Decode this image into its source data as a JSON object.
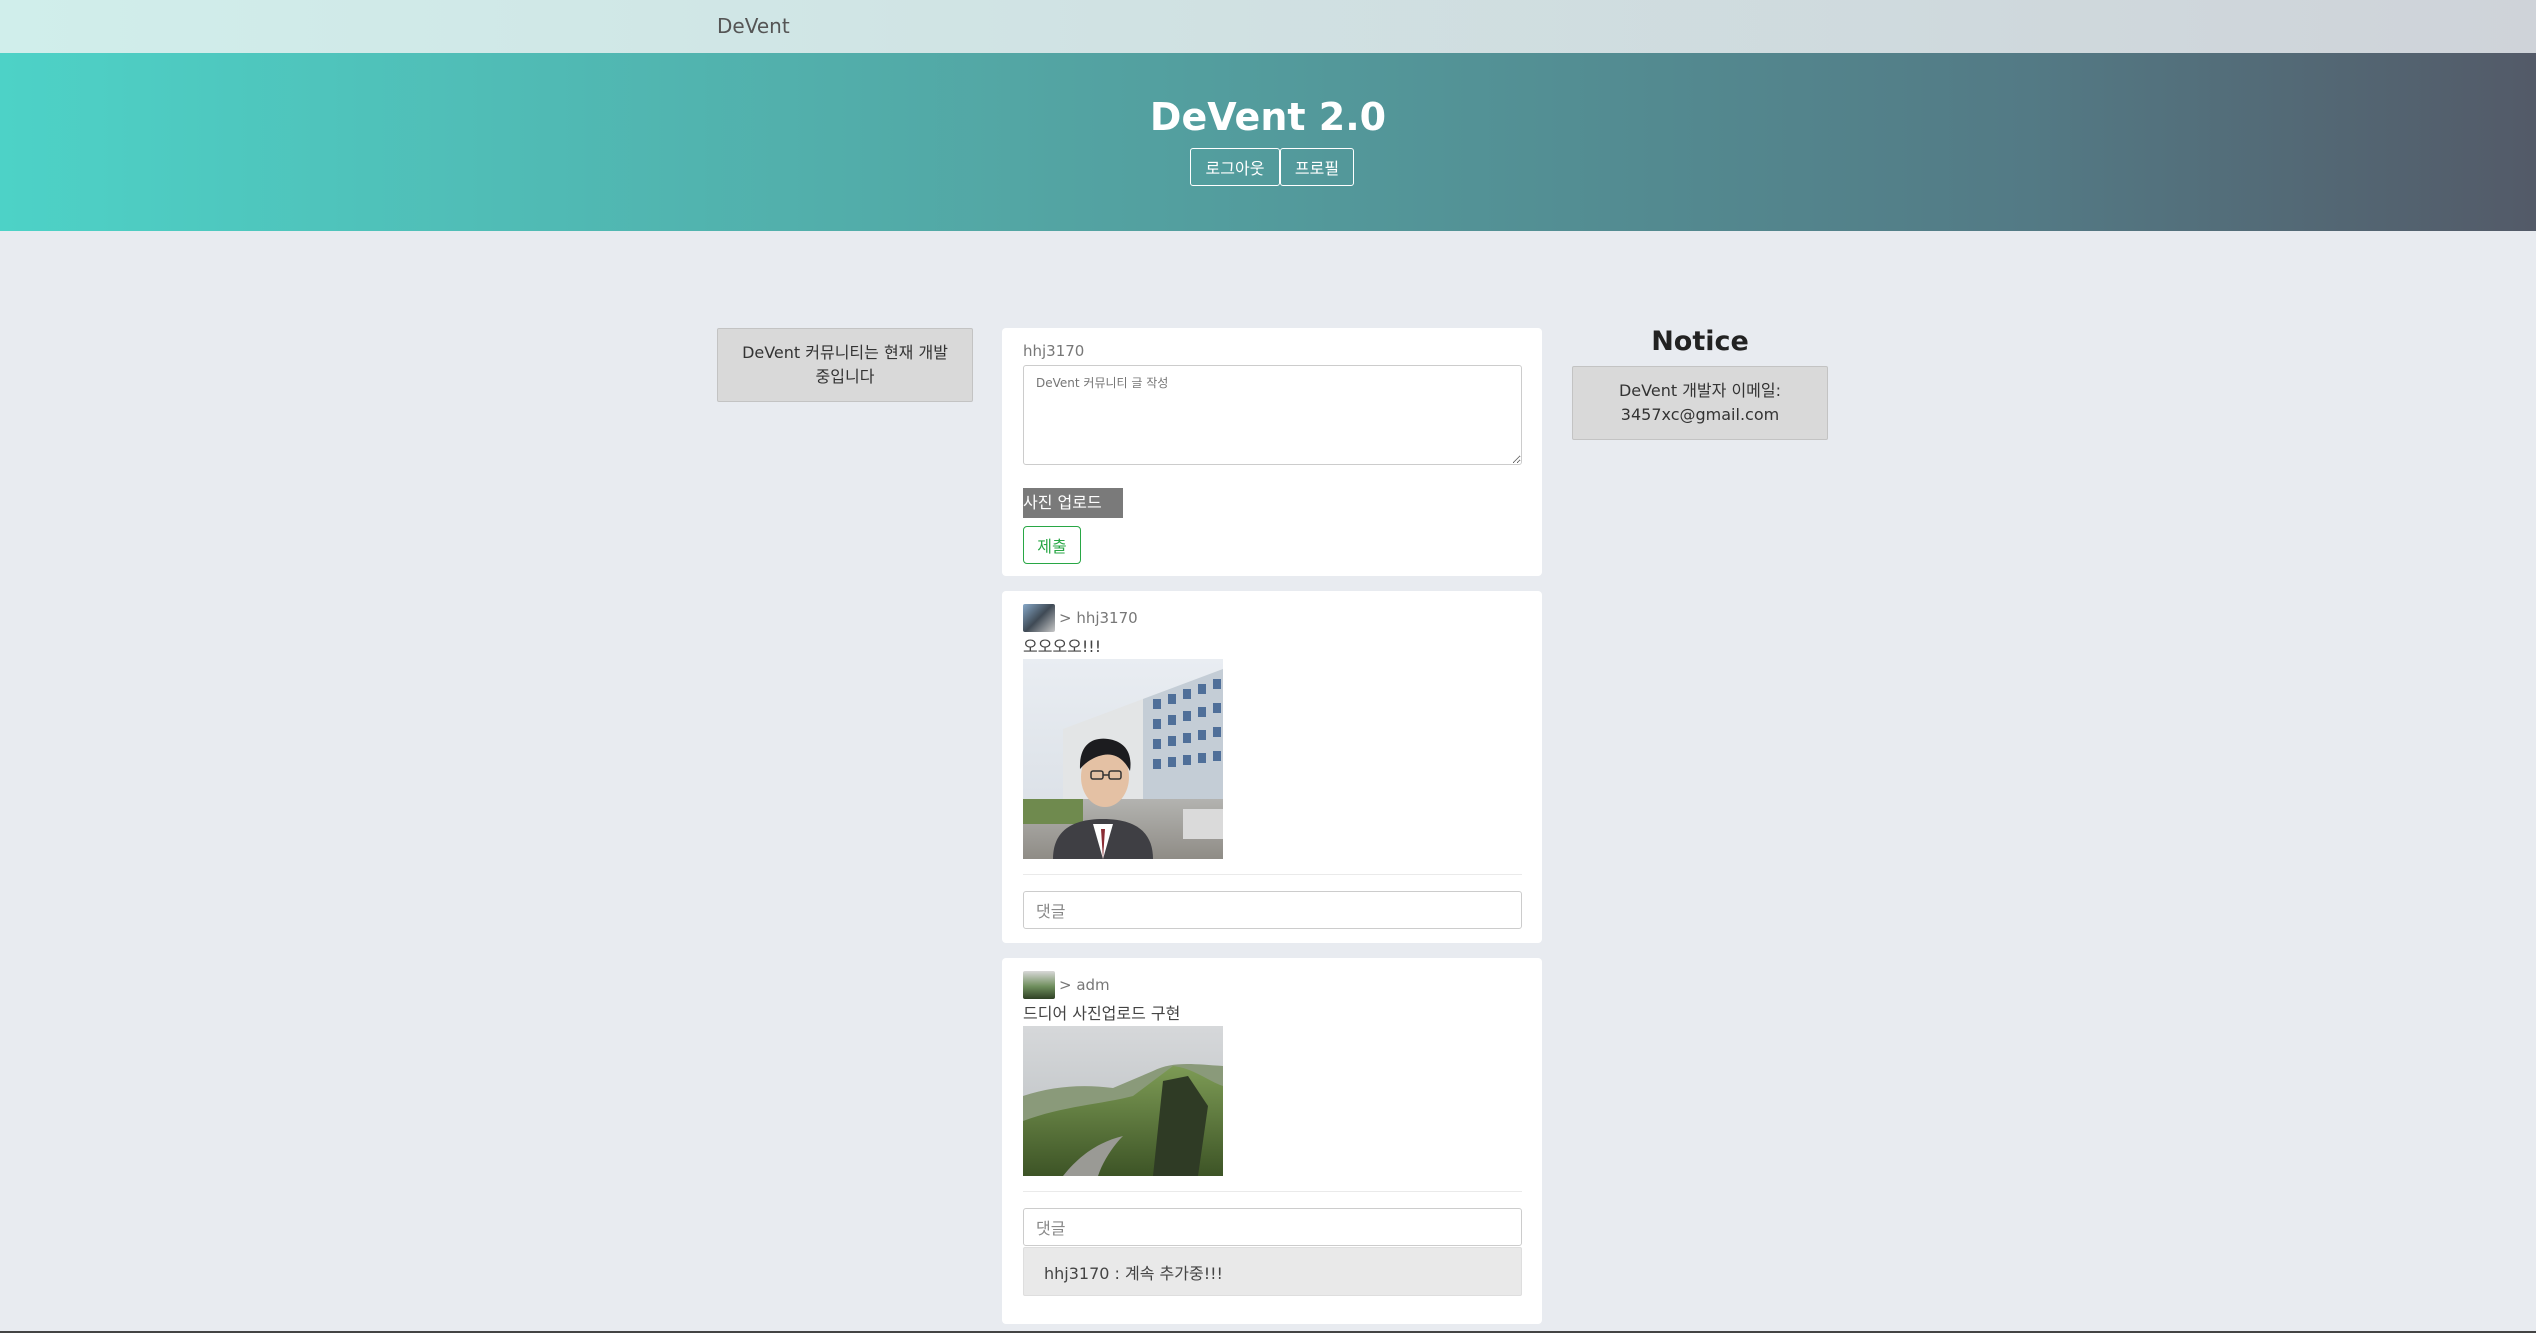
{
  "nav": {
    "brand": "DeVent"
  },
  "hero": {
    "title": "DeVent 2.0",
    "logout_label": "로그아웃",
    "profile_label": "프로필"
  },
  "left_panel": {
    "text": "DeVent 커뮤니티는 현재 개발 중입니다"
  },
  "notice": {
    "title": "Notice",
    "line1": "DeVent 개발자 이메일:",
    "line2": "3457xc@gmail.com"
  },
  "post_form": {
    "username": "hhj3170",
    "placeholder": "DeVent 커뮤니티 글 작성",
    "upload_label": "사진 업로드",
    "submit_label": "제출"
  },
  "posts": [
    {
      "author": "> hhj3170",
      "text": "오오오오!!!",
      "comment_placeholder": "댓글",
      "comments": []
    },
    {
      "author": "> adm",
      "text": "드디어 사진업로드 구현",
      "comment_placeholder": "댓글",
      "comments": [
        {
          "text": "hhj3170 : 계속 추가중!!!"
        }
      ]
    }
  ]
}
